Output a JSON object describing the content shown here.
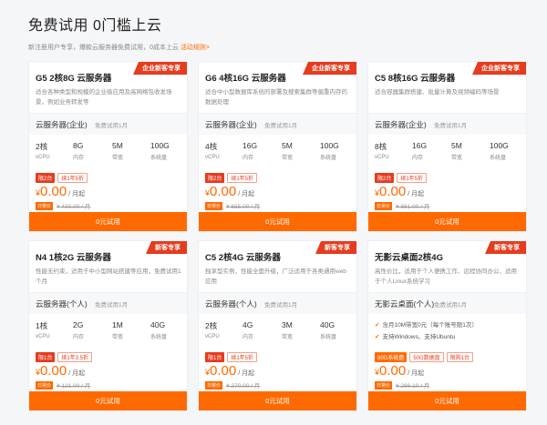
{
  "header": {
    "title": "免费试用 0门槛上云",
    "subtitle_text": "新注册用户专享，爆款云服务器免费试用，0成本上云",
    "rule_link": "活动规则>"
  },
  "cards": [
    {
      "ribbon": "企业新客专享",
      "title": "G5 2核8G 云服务器",
      "desc": "适合各种类型和规模的企业级应用及高网络包收发场景，例如业务转发等",
      "config_name": "云服务器(企业)",
      "duration": "免费试用1月",
      "specs": [
        {
          "value": "2核",
          "label": "vCPU"
        },
        {
          "value": "8G",
          "label": "内存"
        },
        {
          "value": "5M",
          "label": "带宽"
        },
        {
          "value": "100G",
          "label": "系统盘"
        }
      ],
      "tags": [
        {
          "kind": "limit",
          "text": "限2台"
        },
        {
          "kind": "outline",
          "text": "续1年5折"
        }
      ],
      "price_symbol": "¥",
      "price": "0.00",
      "price_unit": "/ 月起",
      "orig_tag": "日常价",
      "orig_price": "¥ 430.00 / 月",
      "cta": "0元试用"
    },
    {
      "ribbon": "企业新客专享",
      "title": "G6 4核16G 云服务器",
      "desc": "适合中小型数据库系统的部署及搜索集群等偏重内存的数据处理",
      "config_name": "云服务器(企业)",
      "duration": "免费试用1月",
      "specs": [
        {
          "value": "4核",
          "label": "vCPU"
        },
        {
          "value": "16G",
          "label": "内存"
        },
        {
          "value": "5M",
          "label": "带宽"
        },
        {
          "value": "100G",
          "label": "系统盘"
        }
      ],
      "tags": [
        {
          "kind": "limit",
          "text": "限2台"
        },
        {
          "kind": "outline",
          "text": "续1年5折"
        }
      ],
      "price_symbol": "¥",
      "price": "0.00",
      "price_unit": "/ 月起",
      "orig_tag": "日常价",
      "orig_price": "¥ 655.00 / 月",
      "cta": "0元试用"
    },
    {
      "ribbon": "企业新客专享",
      "title": "C5 8核16G 云服务器",
      "desc": "适合容器集群搭建、批量计算及视频编码等场景",
      "config_name": "云服务器(企业)",
      "duration": "免费试用1月",
      "specs": [
        {
          "value": "8核",
          "label": "vCPU"
        },
        {
          "value": "16G",
          "label": "内存"
        },
        {
          "value": "5M",
          "label": "带宽"
        },
        {
          "value": "100G",
          "label": "系统盘"
        }
      ],
      "tags": [
        {
          "kind": "limit",
          "text": "限2台"
        },
        {
          "kind": "outline",
          "text": "续1年5折"
        }
      ],
      "price_symbol": "¥",
      "price": "0.00",
      "price_unit": "/ 月起",
      "orig_tag": "日常价",
      "orig_price": "¥ 881.00 / 月",
      "cta": "0元试用"
    },
    {
      "ribbon": "新客专享",
      "title": "N4 1核2G 云服务器",
      "desc": "性能无约束，适用于中小型网站搭建等应用，免费试用1个月",
      "config_name": "云服务器(个人)",
      "duration": "免费试用1月",
      "specs": [
        {
          "value": "1核",
          "label": "vCPU"
        },
        {
          "value": "2G",
          "label": "内存"
        },
        {
          "value": "1M",
          "label": "带宽"
        },
        {
          "value": "40G",
          "label": "系统盘"
        }
      ],
      "tags": [
        {
          "kind": "limit",
          "text": "限1台"
        },
        {
          "kind": "outline",
          "text": "续1年3.5折"
        }
      ],
      "price_symbol": "¥",
      "price": "0.00",
      "price_unit": "/ 月起",
      "orig_tag": "日常价",
      "orig_price": "¥ 121.00 / 月",
      "cta": "0元试用"
    },
    {
      "ribbon": "新客专享",
      "title": "C5 2核4G 云服务器",
      "desc": "独享型实例，性能全面升级，广泛适用于各类通用web应用",
      "config_name": "云服务器(个人)",
      "duration": "免费试用1月",
      "specs": [
        {
          "value": "2核",
          "label": "vCPU"
        },
        {
          "value": "4G",
          "label": "内存"
        },
        {
          "value": "3M",
          "label": "带宽"
        },
        {
          "value": "40G",
          "label": "系统盘"
        }
      ],
      "tags": [
        {
          "kind": "limit",
          "text": "限1台"
        },
        {
          "kind": "outline",
          "text": "续1年5折"
        }
      ],
      "price_symbol": "¥",
      "price": "0.00",
      "price_unit": "/ 月起",
      "orig_tag": "日常价",
      "orig_price": "¥ 270.00 / 月",
      "cta": "0元试用"
    },
    {
      "ribbon": "新客专享",
      "title": "无影云桌面2核4G",
      "desc": "高性价比，适用于个人便携工作、远程协同办公、适用于个人Linux系统学习",
      "config_name": "无影云桌面(个人)",
      "duration": "免费试用1月",
      "features": [
        "含月10M带宽0元（每个账号限1次）",
        "支持Windows、支持Ubuntu"
      ],
      "tags": [
        {
          "kind": "plain",
          "text": "80G系统盘"
        },
        {
          "kind": "outline",
          "text": "50G数据盘"
        },
        {
          "kind": "outline",
          "text": "限购1台"
        }
      ],
      "price_symbol": "¥",
      "price": "0.00",
      "price_unit": "/ 月起",
      "orig_tag": "日常价",
      "orig_price": "¥ 286.10 / 月",
      "cta": "0元试用"
    }
  ]
}
